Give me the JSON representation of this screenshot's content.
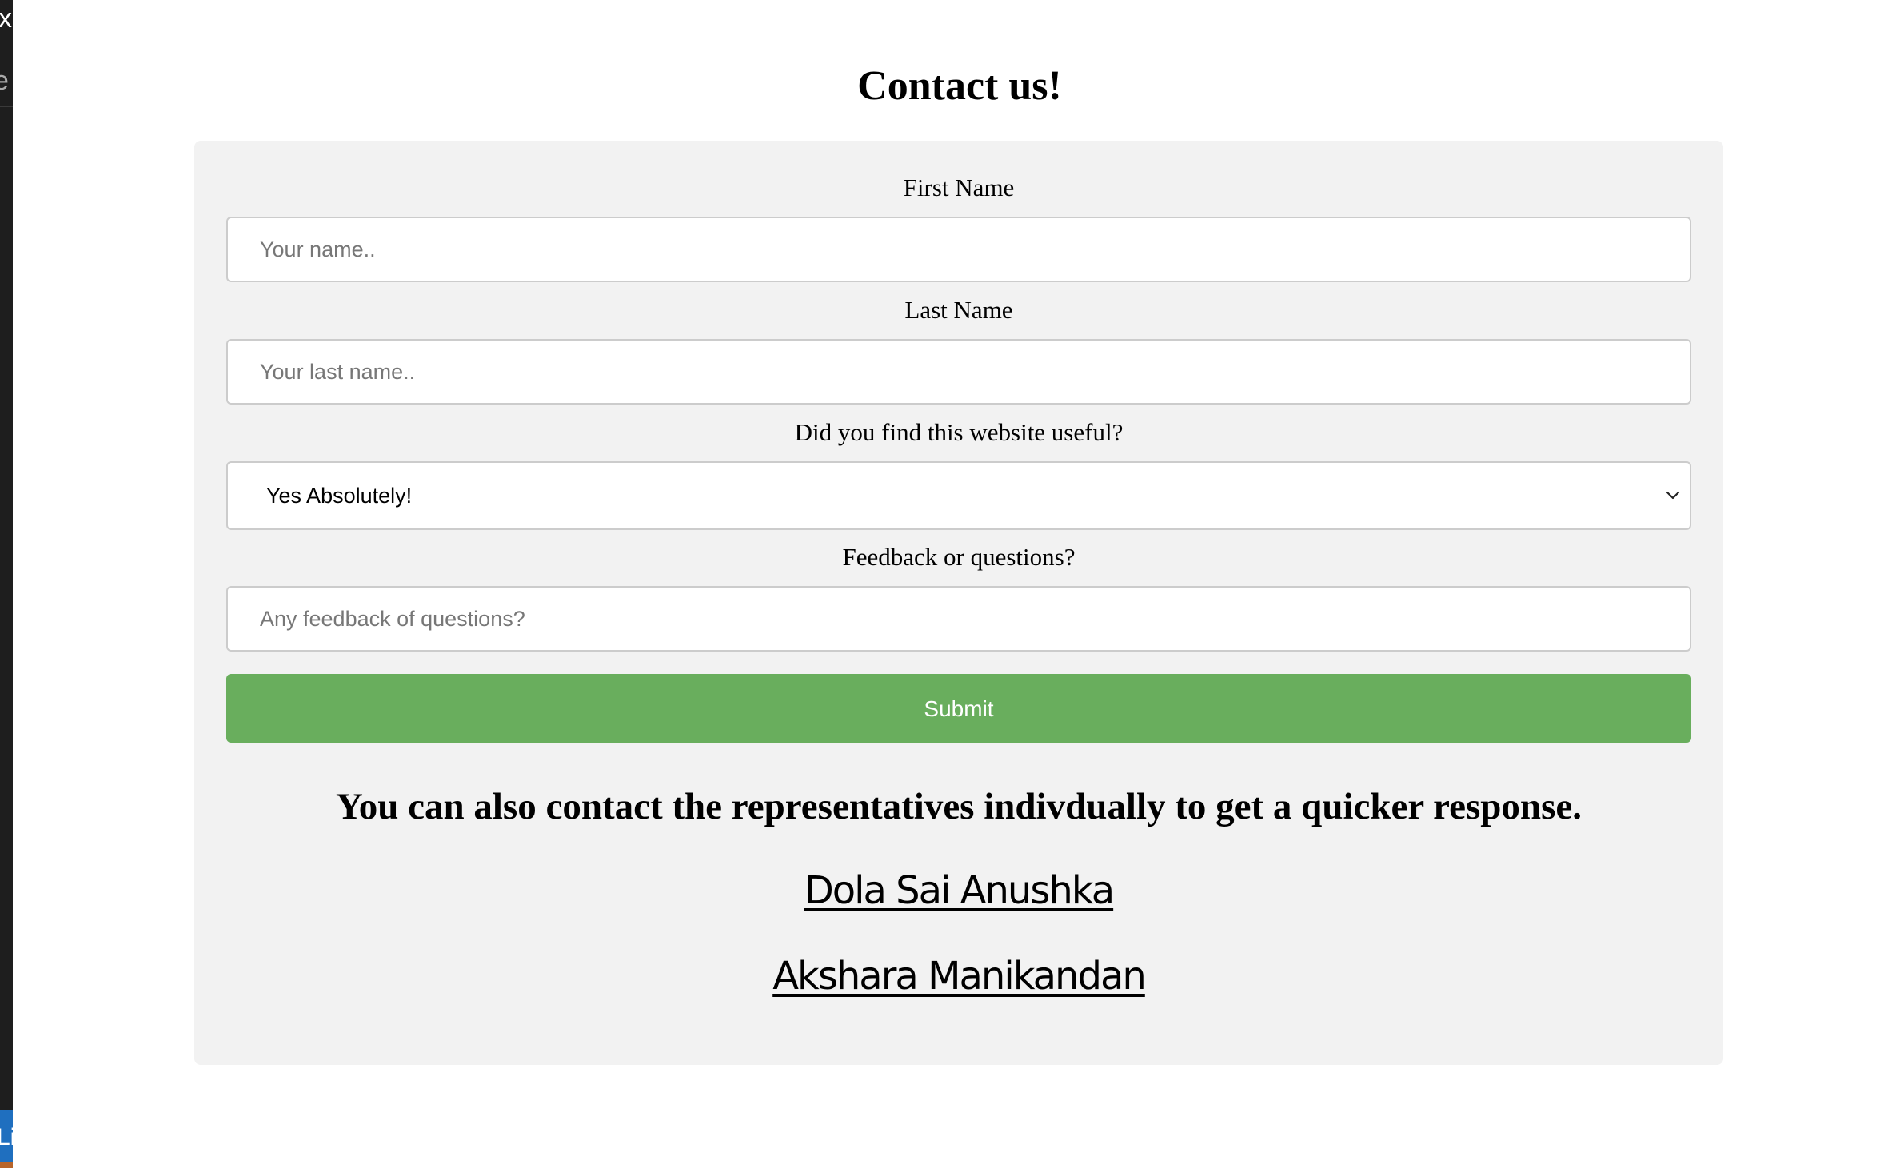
{
  "edge": {
    "top_glyph": "x",
    "second_glyph": "e",
    "bottom_glyph": "Li"
  },
  "page_title": "Contact us!",
  "form": {
    "first_name": {
      "label": "First Name",
      "placeholder": "Your name.."
    },
    "last_name": {
      "label": "Last Name",
      "placeholder": "Your last name.."
    },
    "useful": {
      "label": "Did you find this website useful?",
      "selected": "Yes Absolutely!",
      "icon": "chevron-down-icon"
    },
    "feedback": {
      "label": "Feedback or questions?",
      "placeholder": "Any feedback of questions?"
    },
    "submit_label": "Submit"
  },
  "representatives": {
    "heading": "You can also contact the representatives indivdually to get a quicker response.",
    "names": [
      "Dola Sai Anushka",
      "Akshara Manikandan"
    ]
  },
  "colors": {
    "submit": "#69ae5d",
    "card": "#f2f2f2",
    "input_border": "#cccccc"
  }
}
